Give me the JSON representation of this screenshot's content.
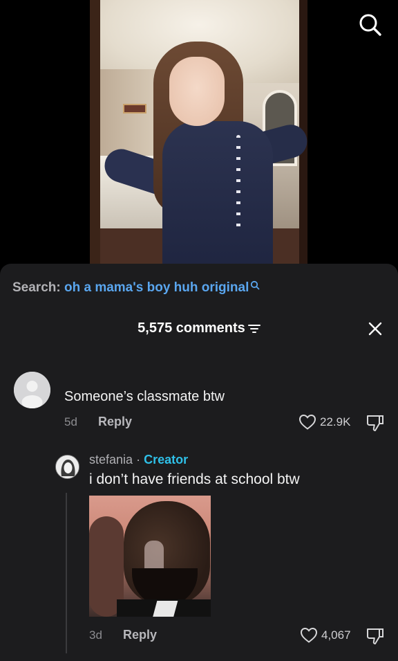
{
  "video": {
    "search_icon": "search-icon"
  },
  "comments_panel": {
    "search": {
      "label": "Search:",
      "query": "oh a mama's boy huh original",
      "icon": "search-icon"
    },
    "header": {
      "count_label": "5,575 comments",
      "filter_icon": "filter-icon",
      "close_icon": "close-icon"
    },
    "comments": [
      {
        "text": "Someone’s classmate btw",
        "time": "5d",
        "reply_label": "Reply",
        "likes": "22.9K",
        "like_icon": "heart-icon",
        "dislike_icon": "thumbs-down-icon"
      }
    ],
    "replies": [
      {
        "author": "stefania",
        "separator": "·",
        "badge": "Creator",
        "text": "i don’t have friends at school btw",
        "time": "3d",
        "reply_label": "Reply",
        "likes": "4,067",
        "like_icon": "heart-icon",
        "dislike_icon": "thumbs-down-icon"
      }
    ]
  },
  "colors": {
    "sheet_bg": "#1c1c1e",
    "search_query": "#5aa6ef",
    "creator_badge": "#2fc0e8"
  }
}
